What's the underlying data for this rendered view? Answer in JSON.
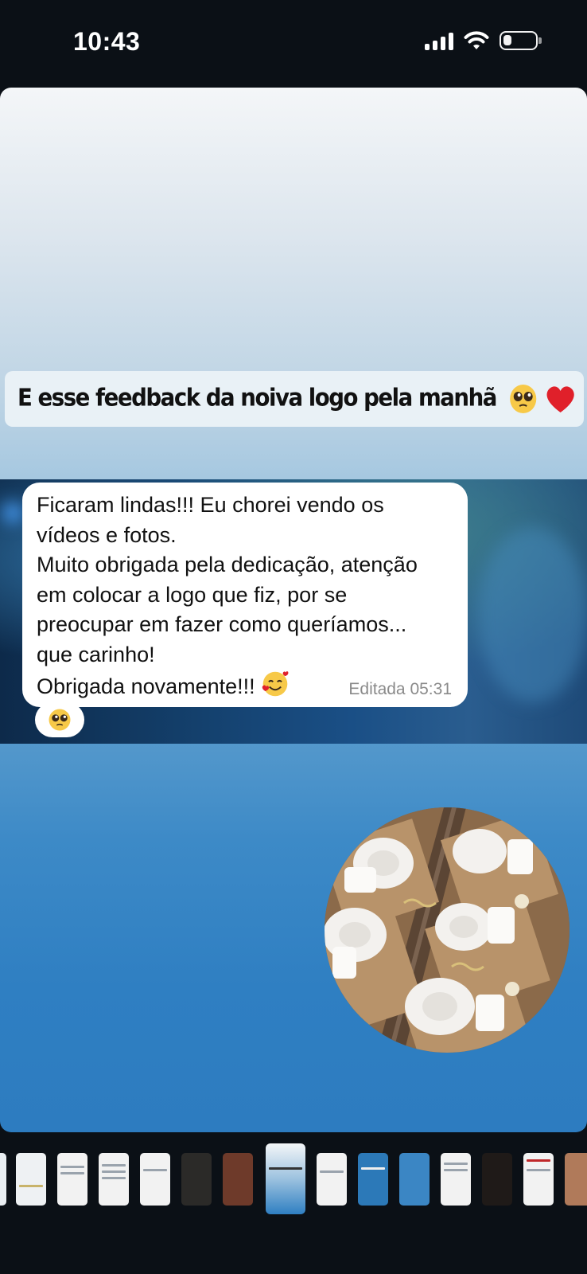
{
  "status_bar": {
    "time": "10:43",
    "signal_icon": "cellular-signal-icon",
    "wifi_icon": "wifi-icon",
    "battery_icon": "battery-icon",
    "battery_level": 0.25
  },
  "story": {
    "caption": "E esse feedback da noiva logo pela manhã",
    "caption_emojis": [
      "pleading-face-icon",
      "red-heart-icon"
    ],
    "message": {
      "text": "Ficaram lindas!!! Eu chorei vendo os\nvídeos e fotos.\nMuito obrigada pela dedicação, atenção\nem colocar a logo que fiz, por se\npreocupar em fazer como queríamos...\nque carinho!\nObrigada novamente!!!",
      "trailing_emoji": "smiling-face-with-hearts-icon",
      "meta": "Editada 05:31",
      "reaction_emoji": "pleading-face-icon"
    },
    "photo": "cups-and-saucers-gift-boxes"
  },
  "colors": {
    "caption_bg": "#ebf2f7",
    "bubble_bg": "#ffffff",
    "meta_text": "#8a8a8a",
    "story_bottom": "#2d7cc0"
  },
  "thumbnails_count": 15,
  "active_thumbnail_index": 7
}
